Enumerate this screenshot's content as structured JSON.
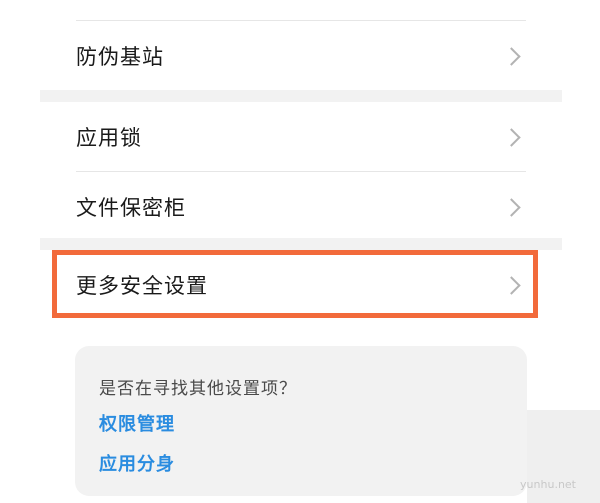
{
  "rows": {
    "anti_fake_base_station": "防伪基站",
    "app_lock": "应用锁",
    "file_safe": "文件保密柜",
    "more_security_settings": "更多安全设置"
  },
  "suggestion_card": {
    "question": "是否在寻找其他设置项？",
    "links": [
      "权限管理",
      "应用分身"
    ]
  },
  "watermark": "yunhu.net",
  "colors": {
    "highlight_border": "#f26a3b",
    "link": "#2a8ce0",
    "section_gap": "#f2f2f2"
  }
}
